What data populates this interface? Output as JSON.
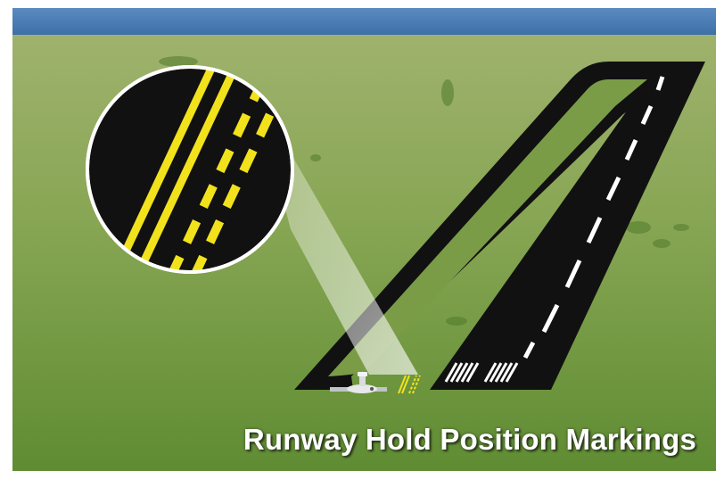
{
  "caption": {
    "text": "Runway Hold Position Markings"
  },
  "colors": {
    "sky": "#4f7fb3",
    "grass_light": "#a3b573",
    "grass_dark": "#5e8a32",
    "pavement": "#111111",
    "hold_marking": "#f2e21c",
    "runway_marking": "#ffffff"
  },
  "icons": {
    "aircraft": "aircraft-icon",
    "magnifier": "magnifier-lens"
  }
}
